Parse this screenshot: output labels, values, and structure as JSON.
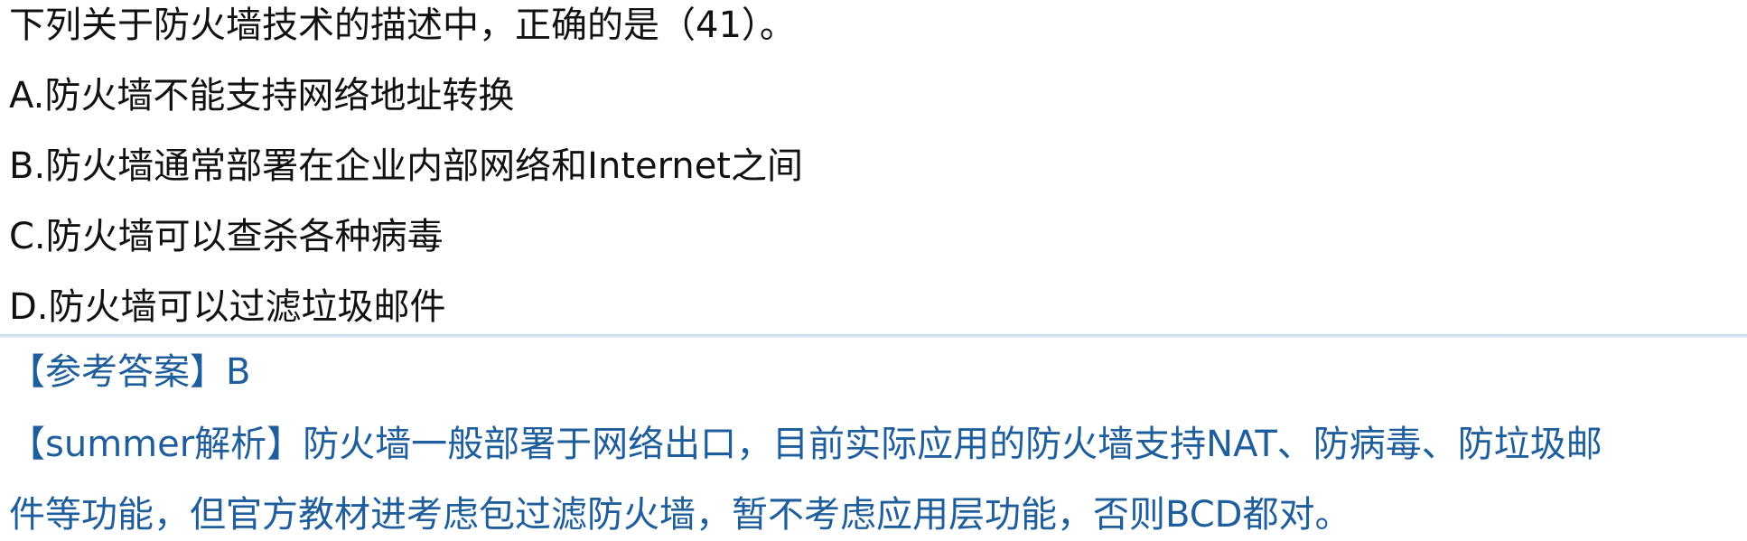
{
  "question": {
    "stem": "下列关于防火墙技术的描述中，正确的是（41）。",
    "options": [
      "A.防火墙不能支持网络地址转换",
      "B.防火墙通常部署在企业内部网络和Internet之间",
      "C.防火墙可以查杀各种病毒",
      "D.防火墙可以过滤垃圾邮件"
    ]
  },
  "answer": {
    "reference": "【参考答案】B",
    "analysis_line1": "【summer解析】防火墙一般部署于网络出口，目前实际应用的防火墙支持NAT、防病毒、防垃圾邮",
    "analysis_line2": "件等功能，但官方教材进考虑包过滤防火墙，暂不考虑应用层功能，否则BCD都对。"
  },
  "colors": {
    "question_text": "#111111",
    "answer_text": "#1f5e9c",
    "divider": "#bcd3ea"
  }
}
